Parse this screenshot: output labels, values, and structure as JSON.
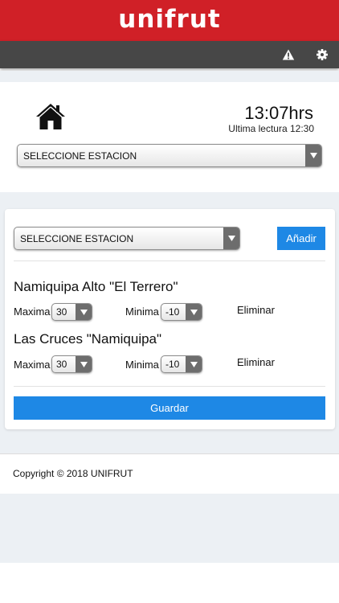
{
  "header": {
    "logo_text": "unifrut",
    "brand_color": "#d02027"
  },
  "toolbar": {
    "color": "#474747",
    "icons": [
      "warning-icon",
      "gear-icon"
    ]
  },
  "status": {
    "time": "13:07hrs",
    "last_reading": "Ultima lectura 12:30"
  },
  "station_select": {
    "selected": "SELECCIONE ESTACION"
  },
  "editor": {
    "station_select": {
      "selected": "SELECCIONE ESTACION"
    },
    "add_label": "Añadir",
    "save_label": "Guardar",
    "stations": [
      {
        "name": "Namiquipa Alto \"El Terrero\"",
        "max_label": "Maxima",
        "max_value": "30",
        "min_label": "Minima",
        "min_value": "-10",
        "delete_label": "Eliminar"
      },
      {
        "name": "Las Cruces \"Namiquipa\"",
        "max_label": "Maxima",
        "max_value": "30",
        "min_label": "Minima",
        "min_value": "-10",
        "delete_label": "Eliminar"
      }
    ]
  },
  "footer": {
    "copyright": "Copyright © 2018 UNIFRUT"
  },
  "accent_color": "#1e88e5"
}
